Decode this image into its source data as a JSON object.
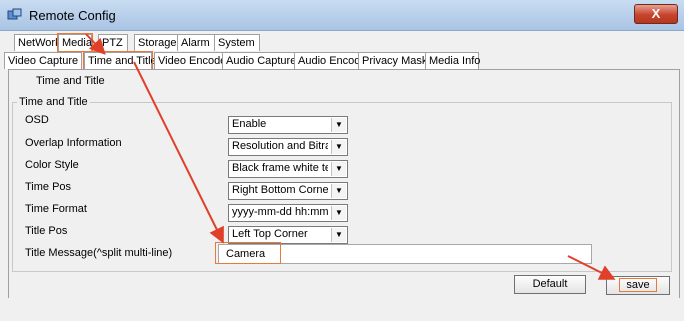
{
  "window": {
    "title": "Remote Config",
    "close_label": "X"
  },
  "tabs_top": [
    "NetWork",
    "Media",
    "PTZ",
    "Storage",
    "Alarm",
    "System"
  ],
  "tabs_sub": [
    "Video Capture",
    "Time and Title",
    "Video Encode",
    "Audio Capture",
    "Audio Encode",
    "Privacy Mask",
    "Media Info"
  ],
  "pane": {
    "label": "Time and Title"
  },
  "group": {
    "title": "Time and Title",
    "rows": [
      {
        "label": "OSD",
        "value": "Enable"
      },
      {
        "label": "Overlap Information",
        "value": "Resolution and Bitrate"
      },
      {
        "label": "Color Style",
        "value": "Black frame white text o"
      },
      {
        "label": "Time Pos",
        "value": "Right Bottom Corner"
      },
      {
        "label": "Time Format",
        "value": "yyyy-mm-dd hh:mm:ss"
      },
      {
        "label": "Title Pos",
        "value": "Left Top Corner"
      }
    ],
    "message_label": "Title Message(^split multi-line)",
    "message_value": "Camera"
  },
  "buttons": {
    "default": "Default",
    "save": "save"
  },
  "colors": {
    "highlight": "#e8793b",
    "arrow": "#e0402a"
  }
}
